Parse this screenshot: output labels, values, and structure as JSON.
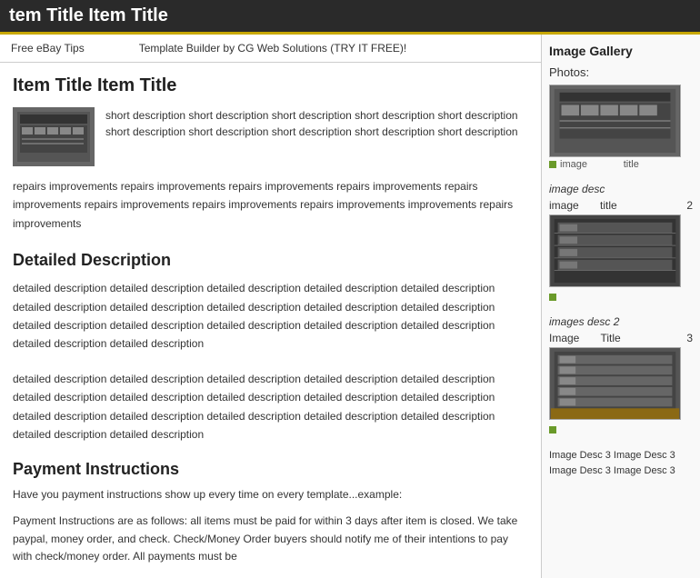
{
  "titleBar": {
    "text": "tem Title Item Title"
  },
  "topBar": {
    "left": "Free eBay Tips",
    "right": "Template Builder by CG Web Solutions (TRY IT FREE)!"
  },
  "itemTitle": "Item Title Item Title",
  "shortDescription": "short description short description short description short description short description short description short description short description short description short description",
  "repairsText": "repairs improvements repairs improvements repairs improvements repairs improvements repairs improvements repairs improvements repairs improvements repairs improvements improvements repairs improvements",
  "detailedTitle": "Detailed Description",
  "detailBlock1": "detailed description detailed description detailed description detailed description detailed description detailed description detailed description detailed description detailed description detailed description detailed description detailed description detailed description detailed description detailed description detailed description detailed description",
  "detailBlock2": "detailed description detailed description detailed description detailed description detailed description detailed description detailed description detailed description detailed description detailed description detailed description detailed description detailed description detailed description detailed description detailed description detailed description",
  "paymentTitle": "Payment Instructions",
  "paymentIntro": "Have you payment instructions show up every time on every template...example:",
  "paymentDetails": "Payment Instructions are as follows: all items must be paid for within 3 days after item is closed. We take paypal, money order, and check. Check/Money Order buyers should notify me of their intentions to pay with check/money order. All payments must be",
  "sidebar": {
    "galleryTitle": "Image Gallery",
    "photosLabel": "Photos:",
    "images": [
      {
        "label": "image",
        "title": "title",
        "desc": "",
        "num": ""
      },
      {
        "label": "image",
        "title": "title",
        "desc": "image desc",
        "num": "2"
      },
      {
        "label": "Image",
        "title": "Title",
        "desc": "images desc 2",
        "num": "3"
      }
    ],
    "lastDesc": "Image Desc 3 Image Desc 3 Image Desc 3 Image Desc 3"
  }
}
